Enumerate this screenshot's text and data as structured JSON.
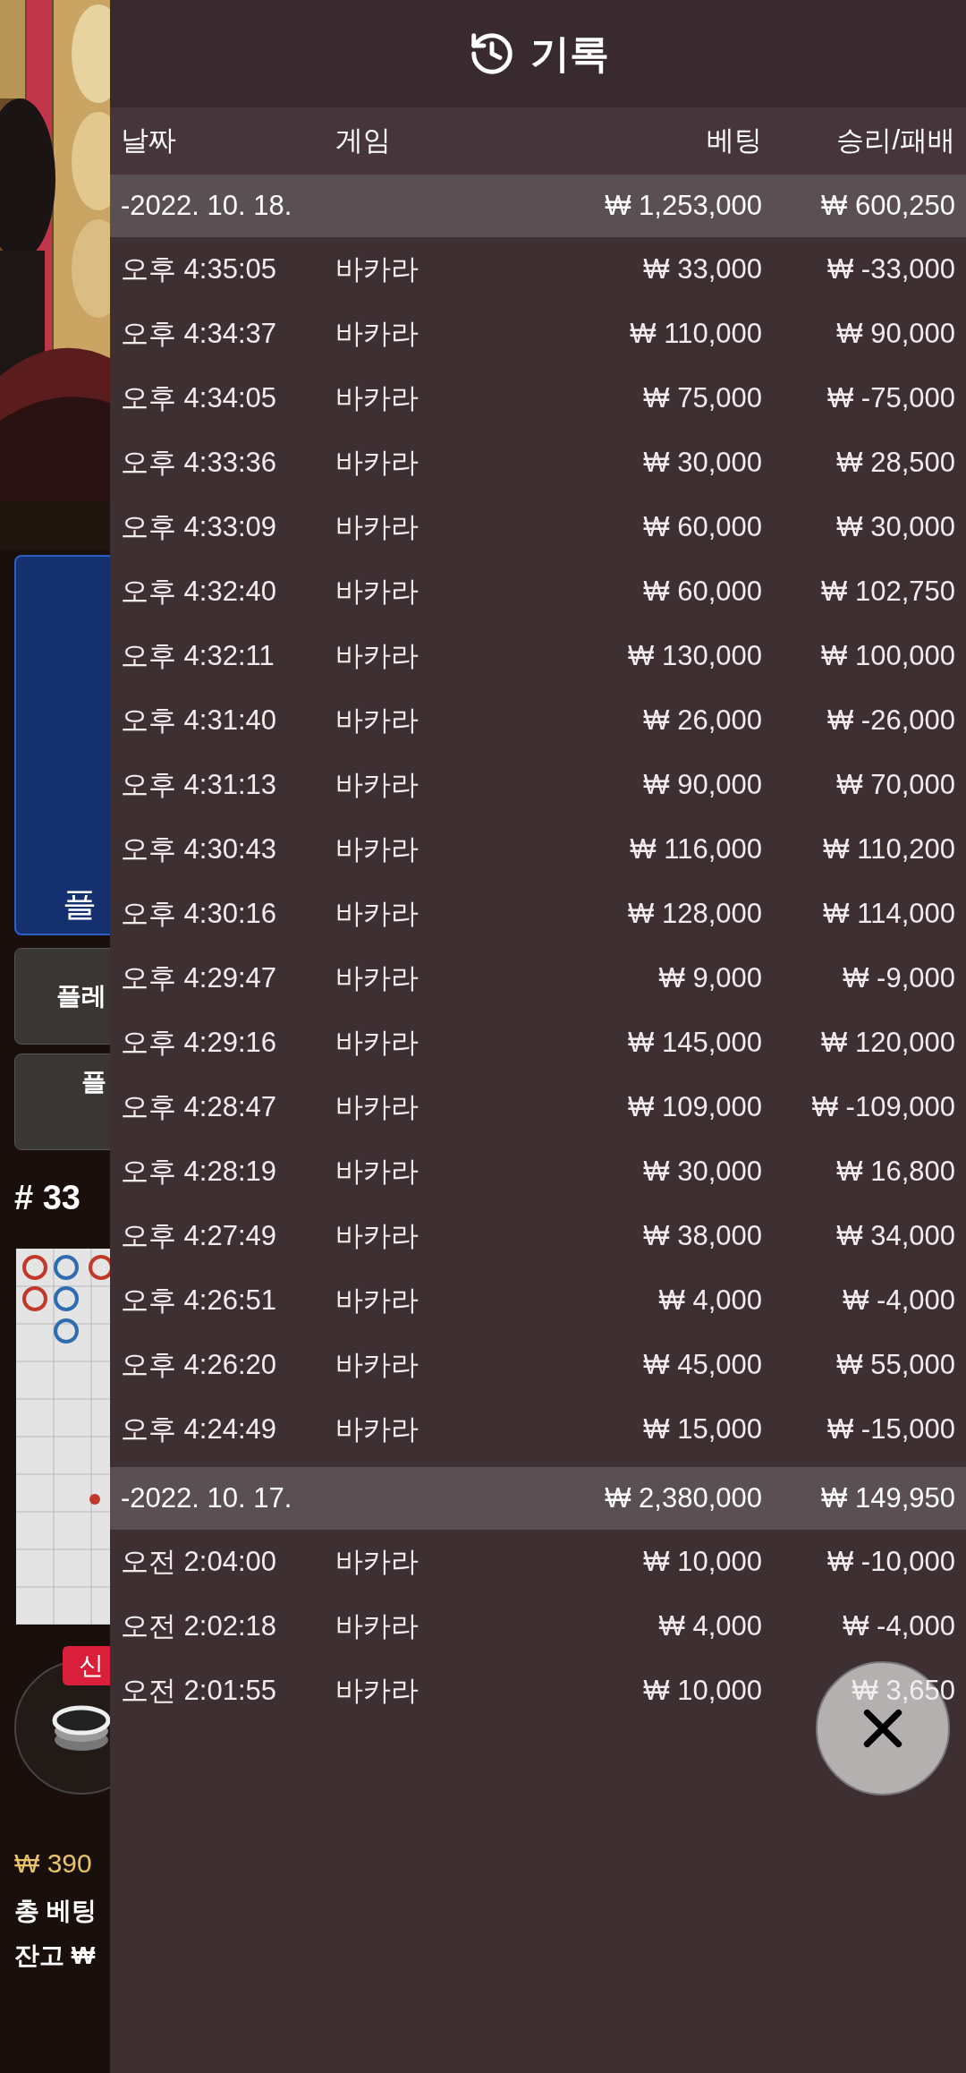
{
  "background": {
    "table_label": "플",
    "buttons": [
      "플레",
      "플"
    ],
    "round": "# 33",
    "badge": "신",
    "balance": "₩ 390",
    "total_bet": "총 베팅",
    "wallet": "잔고 ₩"
  },
  "history": {
    "title": "기록",
    "columns": [
      "날짜",
      "게임",
      "베팅",
      "승리/패배"
    ],
    "groups": [
      {
        "date": "-2022. 10. 18.",
        "bet_total": "₩ 1,253,000",
        "win_total": "₩ 600,250",
        "rows": [
          {
            "time": "오후 4:35:05",
            "game": "바카라",
            "bet": "₩ 33,000",
            "result": "₩ -33,000"
          },
          {
            "time": "오후 4:34:37",
            "game": "바카라",
            "bet": "₩ 110,000",
            "result": "₩ 90,000"
          },
          {
            "time": "오후 4:34:05",
            "game": "바카라",
            "bet": "₩ 75,000",
            "result": "₩ -75,000"
          },
          {
            "time": "오후 4:33:36",
            "game": "바카라",
            "bet": "₩ 30,000",
            "result": "₩ 28,500"
          },
          {
            "time": "오후 4:33:09",
            "game": "바카라",
            "bet": "₩ 60,000",
            "result": "₩ 30,000"
          },
          {
            "time": "오후 4:32:40",
            "game": "바카라",
            "bet": "₩ 60,000",
            "result": "₩ 102,750"
          },
          {
            "time": "오후 4:32:11",
            "game": "바카라",
            "bet": "₩ 130,000",
            "result": "₩ 100,000"
          },
          {
            "time": "오후 4:31:40",
            "game": "바카라",
            "bet": "₩ 26,000",
            "result": "₩ -26,000"
          },
          {
            "time": "오후 4:31:13",
            "game": "바카라",
            "bet": "₩ 90,000",
            "result": "₩ 70,000"
          },
          {
            "time": "오후 4:30:43",
            "game": "바카라",
            "bet": "₩ 116,000",
            "result": "₩ 110,200"
          },
          {
            "time": "오후 4:30:16",
            "game": "바카라",
            "bet": "₩ 128,000",
            "result": "₩ 114,000"
          },
          {
            "time": "오후 4:29:47",
            "game": "바카라",
            "bet": "₩ 9,000",
            "result": "₩ -9,000"
          },
          {
            "time": "오후 4:29:16",
            "game": "바카라",
            "bet": "₩ 145,000",
            "result": "₩ 120,000"
          },
          {
            "time": "오후 4:28:47",
            "game": "바카라",
            "bet": "₩ 109,000",
            "result": "₩ -109,000"
          },
          {
            "time": "오후 4:28:19",
            "game": "바카라",
            "bet": "₩ 30,000",
            "result": "₩ 16,800"
          },
          {
            "time": "오후 4:27:49",
            "game": "바카라",
            "bet": "₩ 38,000",
            "result": "₩ 34,000"
          },
          {
            "time": "오후 4:26:51",
            "game": "바카라",
            "bet": "₩ 4,000",
            "result": "₩ -4,000"
          },
          {
            "time": "오후 4:26:20",
            "game": "바카라",
            "bet": "₩ 45,000",
            "result": "₩ 55,000"
          },
          {
            "time": "오후 4:24:49",
            "game": "바카라",
            "bet": "₩ 15,000",
            "result": "₩ -15,000"
          }
        ]
      },
      {
        "date": "-2022. 10. 17.",
        "bet_total": "₩ 2,380,000",
        "win_total": "₩ 149,950",
        "rows": [
          {
            "time": "오전 2:04:00",
            "game": "바카라",
            "bet": "₩ 10,000",
            "result": "₩ -10,000"
          },
          {
            "time": "오전 2:02:18",
            "game": "바카라",
            "bet": "₩ 4,000",
            "result": "₩ -4,000"
          },
          {
            "time": "오전 2:01:55",
            "game": "바카라",
            "bet": "₩ 10,000",
            "result": "₩ 3,650"
          }
        ]
      }
    ]
  }
}
